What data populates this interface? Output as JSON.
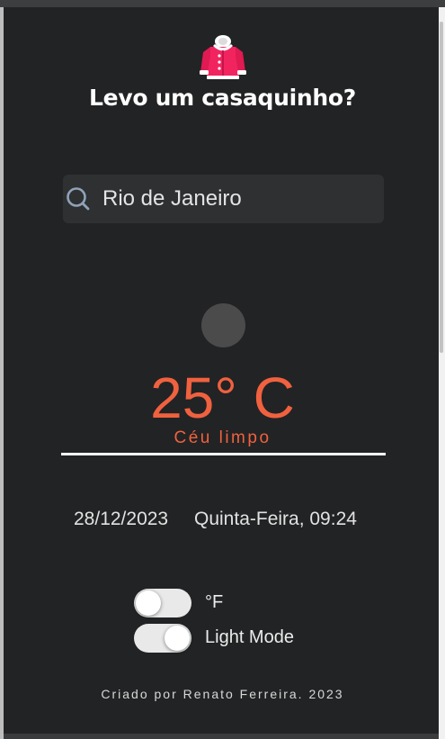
{
  "header": {
    "logo_icon": "pink-jacket-icon",
    "title": "Levo um casaquinho?"
  },
  "search": {
    "icon": "search-icon",
    "value": "Rio de Janeiro"
  },
  "weather": {
    "icon": "weather-icon",
    "temperature": "25° C",
    "condition": "Céu limpo"
  },
  "datetime": {
    "date": "28/12/2023",
    "weekday_time": "Quinta-Feira, 09:24"
  },
  "settings": {
    "fahrenheit_label": "°F",
    "fahrenheit_on": false,
    "light_mode_label": "Light Mode",
    "light_mode_on": true
  },
  "footer": {
    "credit": "Criado por Renato Ferreira. 2023"
  },
  "colors": {
    "accent": "#f0613f",
    "background": "#222324",
    "search_bg": "#2e3031",
    "jacket": "#f2245f"
  }
}
